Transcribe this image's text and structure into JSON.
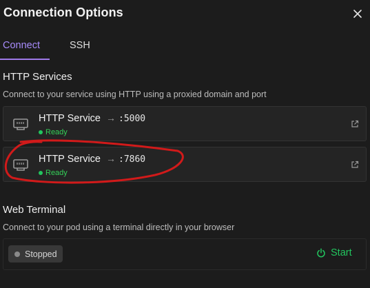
{
  "dialog": {
    "title": "Connection Options",
    "close_icon": "close-icon"
  },
  "tabs": [
    {
      "label": "Connect",
      "active": true
    },
    {
      "label": "SSH",
      "active": false
    }
  ],
  "http": {
    "title": "HTTP Services",
    "description": "Connect to your service using HTTP using a proxied domain and port",
    "services": [
      {
        "name": "HTTP Service",
        "arrow": "→",
        "port": ":5000",
        "status": "Ready"
      },
      {
        "name": "HTTP Service",
        "arrow": "→",
        "port": ":7860",
        "status": "Ready"
      }
    ]
  },
  "terminal": {
    "title": "Web Terminal",
    "description": "Connect to your pod using a terminal directly in your browser",
    "status": "Stopped",
    "start_label": "Start"
  },
  "colors": {
    "accent": "#a78bfa",
    "ready": "#22c55e",
    "annotation": "#d11a1a"
  }
}
